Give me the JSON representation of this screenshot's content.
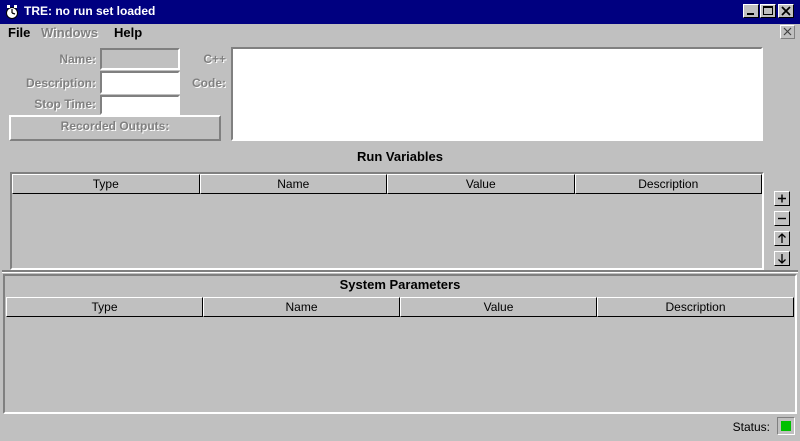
{
  "window": {
    "title": "TRE:  no run set loaded",
    "title_bar_color": "#000080"
  },
  "menu": {
    "file": "File",
    "windows": "Windows",
    "help": "Help"
  },
  "form": {
    "name_label": "Name:",
    "description_label": "Description:",
    "stop_time_label": "Stop Time:",
    "recorded_outputs_label": "Recorded Outputs:",
    "cpp_label": "C++",
    "code_label": "Code:",
    "name_value": "",
    "description_value": "",
    "stop_time_value": "",
    "code_value": ""
  },
  "run_variables": {
    "title": "Run Variables",
    "columns": [
      "Type",
      "Name",
      "Value",
      "Description"
    ],
    "rows": []
  },
  "side_buttons": [
    "plus-icon",
    "minus-icon",
    "arrow-up-icon",
    "arrow-down-icon"
  ],
  "system_parameters": {
    "title": "System Parameters",
    "columns": [
      "Type",
      "Name",
      "Value",
      "Description"
    ],
    "rows": []
  },
  "status": {
    "label": "Status:",
    "indicator_color": "#00c000"
  }
}
